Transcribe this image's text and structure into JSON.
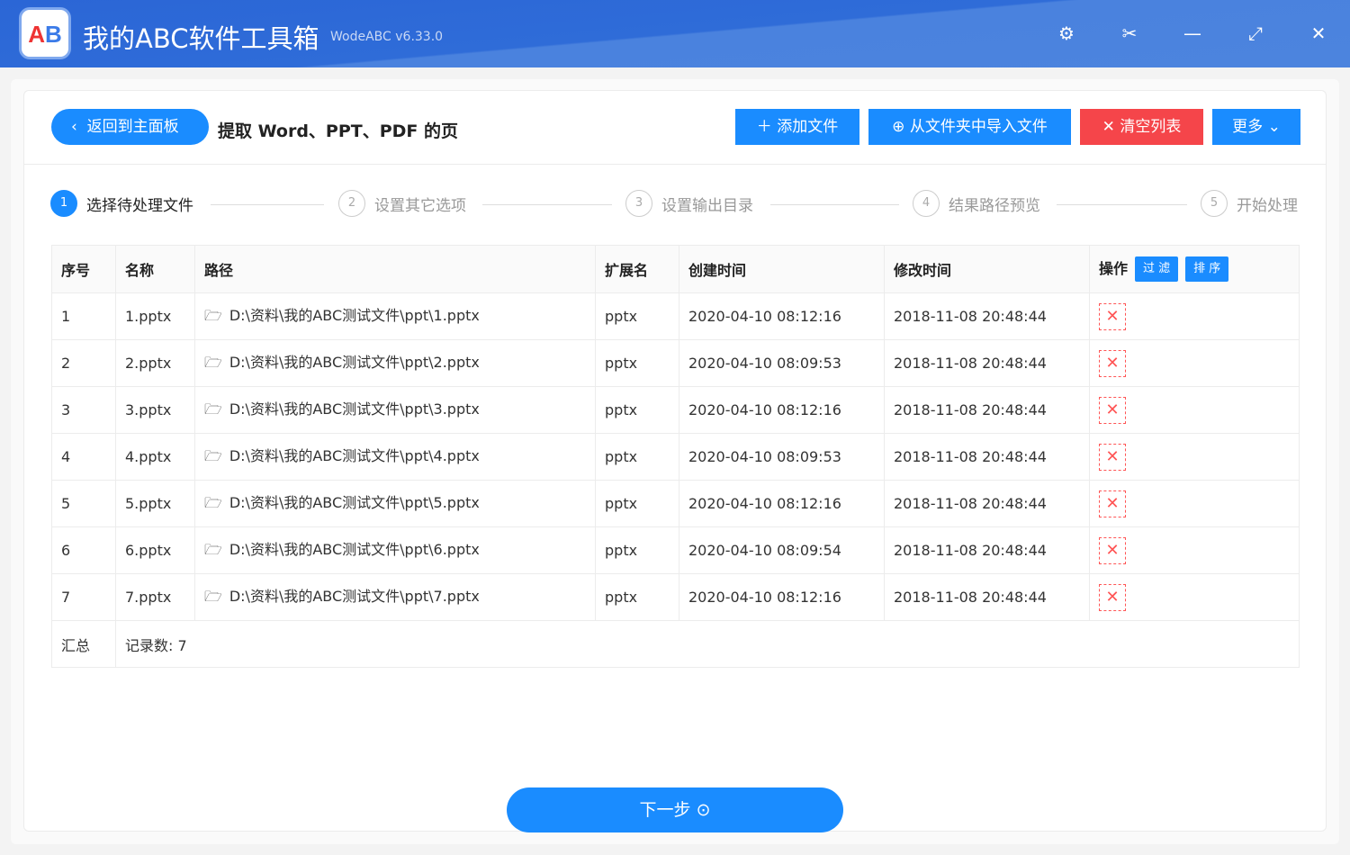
{
  "app": {
    "title": "我的ABC软件工具箱",
    "version": "WodeABC v6.33.0"
  },
  "header": {
    "back": "返回到主面板",
    "title": "提取 Word、PPT、PDF 的页",
    "add": "添加文件",
    "import": "从文件夹中导入文件",
    "clear": "清空列表",
    "more": "更多"
  },
  "steps": [
    {
      "n": "1",
      "label": "选择待处理文件"
    },
    {
      "n": "2",
      "label": "设置其它选项"
    },
    {
      "n": "3",
      "label": "设置输出目录"
    },
    {
      "n": "4",
      "label": "结果路径预览"
    },
    {
      "n": "5",
      "label": "开始处理"
    }
  ],
  "table": {
    "headers": [
      "序号",
      "名称",
      "路径",
      "扩展名",
      "创建时间",
      "修改时间",
      "操作"
    ],
    "filter": "过 滤",
    "sort": "排 序",
    "rows": [
      [
        "1",
        "1.pptx",
        "D:\\资料\\我的ABC测试文件\\ppt\\1.pptx",
        "pptx",
        "2020-04-10 08:12:16",
        "2018-11-08 20:48:44"
      ],
      [
        "2",
        "2.pptx",
        "D:\\资料\\我的ABC测试文件\\ppt\\2.pptx",
        "pptx",
        "2020-04-10 08:09:53",
        "2018-11-08 20:48:44"
      ],
      [
        "3",
        "3.pptx",
        "D:\\资料\\我的ABC测试文件\\ppt\\3.pptx",
        "pptx",
        "2020-04-10 08:12:16",
        "2018-11-08 20:48:44"
      ],
      [
        "4",
        "4.pptx",
        "D:\\资料\\我的ABC测试文件\\ppt\\4.pptx",
        "pptx",
        "2020-04-10 08:09:53",
        "2018-11-08 20:48:44"
      ],
      [
        "5",
        "5.pptx",
        "D:\\资料\\我的ABC测试文件\\ppt\\5.pptx",
        "pptx",
        "2020-04-10 08:12:16",
        "2018-11-08 20:48:44"
      ],
      [
        "6",
        "6.pptx",
        "D:\\资料\\我的ABC测试文件\\ppt\\6.pptx",
        "pptx",
        "2020-04-10 08:09:54",
        "2018-11-08 20:48:44"
      ],
      [
        "7",
        "7.pptx",
        "D:\\资料\\我的ABC测试文件\\ppt\\7.pptx",
        "pptx",
        "2020-04-10 08:12:16",
        "2018-11-08 20:48:44"
      ]
    ],
    "summary_label": "汇总",
    "summary_value": "记录数:  7"
  },
  "next": "下一步"
}
